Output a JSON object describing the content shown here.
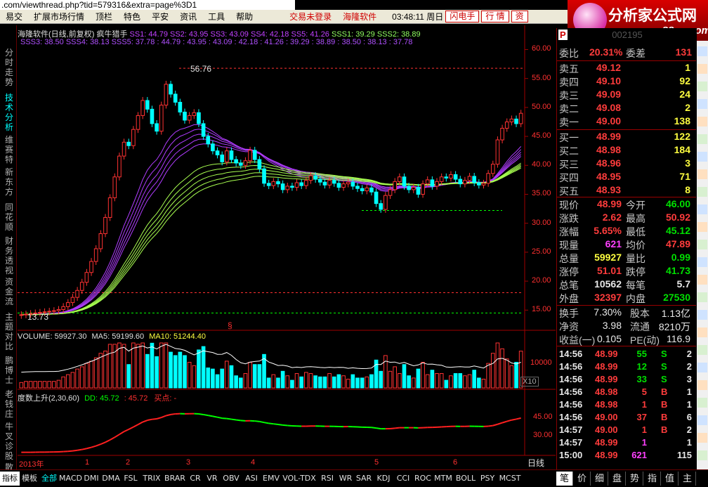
{
  "browser": {
    "url_text": ".com/viewthread.php?tid=579316&extra=page%3D1"
  },
  "menu": {
    "items": [
      "易交",
      "扩展市场行情",
      "顶栏",
      "特色",
      "平安",
      "资讯",
      "工具",
      "帮助"
    ],
    "login": "交易未登录",
    "brand": "海隆软件",
    "clock": "03:48:11 周日",
    "flash": "闪电手",
    "quote": "行 情",
    "info": "资"
  },
  "logo": {
    "title": "分析家公式网",
    "site": "www.88gs.com"
  },
  "left_tabs": [
    "分时走势",
    "技术分析",
    "维赛特",
    "新东方",
    "同花顺",
    "财务透视",
    "资金流",
    "主题对比",
    "鹏博士",
    "老钱庄",
    "牛叉诊股",
    "散户"
  ],
  "chart": {
    "title": "海隆软件(日线,前复权) 疯牛猎手",
    "ss": [
      {
        "label": "SS1: 44.79",
        "color": "#c040ff"
      },
      {
        "label": "SS2: 43.95",
        "color": "#c040ff"
      },
      {
        "label": "SS3: 43.09",
        "color": "#c040ff"
      },
      {
        "label": "SS4: 42.18",
        "color": "#c040ff"
      },
      {
        "label": "SS5: 41.26",
        "color": "#c040ff"
      },
      {
        "label": "SSS1: 39.29",
        "color": "#a0ff60"
      },
      {
        "label": "SSS2: 38.89",
        "color": "#a0ff60"
      }
    ],
    "line2": "SSS3: 38.50  SSS4: 38.13  SSS5: 37.78  :  44.79  : 43.95  : 43.09  : 42.18  : 41.26  : 39.29  : 38.89  : 38.50  : 38.13  : 37.78",
    "high_label": "56.76",
    "low_label": "13.73",
    "price_axis": [
      "60.00",
      "55.00",
      "50.00",
      "45.00",
      "40.00",
      "35.00",
      "30.00",
      "25.00",
      "20.00",
      "15.00"
    ],
    "volume_title": "VOLUME: 59927.30",
    "ma5": "MA5: 59199.60",
    "ma10": "MA10: 51244.40",
    "volume_axis": "10000",
    "volume_unit": "X10",
    "osc_title": "度数上升(2,30,60)",
    "dd": "DD: 45.72",
    "dd2": ": 45.72",
    "buy_point": "买点: -",
    "osc_axis": [
      "45.00",
      "30.00"
    ],
    "x_labels": [
      "2013年",
      "1",
      "2",
      "3",
      "4",
      "5",
      "6"
    ],
    "period": "日线",
    "mark": "§"
  },
  "chart_data": {
    "type": "candlestick",
    "title": "海隆软件(日线,前复权) 疯牛猎手",
    "ylim": [
      12,
      62
    ],
    "high": 56.76,
    "low": 13.73,
    "closes": [
      14.2,
      14.3,
      14.4,
      14.5,
      14.6,
      14.7,
      14.8,
      14.9,
      15.1,
      15.6,
      16.3,
      17.2,
      18.4,
      19.8,
      21.5,
      23.4,
      25.6,
      28.2,
      31.0,
      34.4,
      38.0,
      41.6,
      44.0,
      43.4,
      46.2,
      48.6,
      51.2,
      49.7,
      47.2,
      45.9,
      50.4,
      54.0,
      52.3,
      50.9,
      49.2,
      47.8,
      48.6,
      49.1,
      47.2,
      45.0,
      43.7,
      42.5,
      41.8,
      40.6,
      42.5,
      41.0,
      40.4,
      40.0,
      40.8,
      42.6,
      41.0,
      39.4,
      36.9,
      36.5,
      37.2,
      36.8,
      35.8,
      36.4,
      36.2,
      37.0,
      36.5,
      37.4,
      38.2,
      37.6,
      37.1,
      36.6,
      37.4,
      36.9,
      36.2,
      36.8,
      37.1,
      36.4,
      36.0,
      35.6,
      36.1,
      35.4,
      33.4,
      32.4,
      34.8,
      35.8,
      37.2,
      38.0,
      36.4,
      35.8,
      36.2,
      35.0,
      36.8,
      37.5,
      36.4,
      37.2,
      38.0,
      37.8,
      38.4,
      37.6,
      36.8,
      37.4,
      38.1,
      37.0,
      36.6,
      36.9,
      38.6,
      40.2,
      44.4,
      46.4,
      47.5,
      48.0,
      47.2,
      48.99
    ],
    "volume_ma5": 59199.6,
    "volume_ma10": 51244.4,
    "volume_last": 59927.3,
    "osc_last": 45.72
  },
  "panel": {
    "code": "002195",
    "weibi": {
      "label": "委比",
      "value": "20.31%",
      "label2": "委差",
      "value2": "131"
    },
    "sell": [
      {
        "label": "卖五",
        "price": "49.12",
        "vol": "1"
      },
      {
        "label": "卖四",
        "price": "49.10",
        "vol": "92"
      },
      {
        "label": "卖三",
        "price": "49.09",
        "vol": "24"
      },
      {
        "label": "卖二",
        "price": "49.08",
        "vol": "2"
      },
      {
        "label": "卖一",
        "price": "49.00",
        "vol": "138"
      }
    ],
    "buy": [
      {
        "label": "买一",
        "price": "48.99",
        "vol": "122"
      },
      {
        "label": "买二",
        "price": "48.98",
        "vol": "184"
      },
      {
        "label": "买三",
        "price": "48.96",
        "vol": "3"
      },
      {
        "label": "买四",
        "price": "48.95",
        "vol": "71"
      },
      {
        "label": "买五",
        "price": "48.93",
        "vol": "8"
      }
    ],
    "stats": [
      {
        "l1": "现价",
        "v1": "48.99",
        "c1": "pred",
        "l2": "今开",
        "v2": "46.00",
        "c2": "pgreen"
      },
      {
        "l1": "涨跌",
        "v1": "2.62",
        "c1": "pred",
        "l2": "最高",
        "v2": "50.92",
        "c2": "pred"
      },
      {
        "l1": "涨幅",
        "v1": "5.65%",
        "c1": "pred",
        "l2": "最低",
        "v2": "45.12",
        "c2": "pgreen"
      },
      {
        "l1": "现量",
        "v1": "621",
        "c1": "pmag",
        "l2": "均价",
        "v2": "47.89",
        "c2": "pred"
      },
      {
        "l1": "总量",
        "v1": "59927",
        "c1": "pyellow",
        "l2": "量比",
        "v2": "0.99",
        "c2": "pgreen"
      },
      {
        "l1": "涨停",
        "v1": "51.01",
        "c1": "pred",
        "l2": "跌停",
        "v2": "41.73",
        "c2": "pgreen"
      },
      {
        "l1": "总笔",
        "v1": "10562",
        "c1": "pwhite",
        "l2": "每笔",
        "v2": "5.7",
        "c2": "pwhite"
      },
      {
        "l1": "外盘",
        "v1": "32397",
        "c1": "pred",
        "l2": "内盘",
        "v2": "27530",
        "c2": "pgreen"
      }
    ],
    "fund": [
      {
        "l1": "换手",
        "v1": "7.30%",
        "l2": "股本",
        "v2": "1.13亿"
      },
      {
        "l1": "净资",
        "v1": "3.98",
        "l2": "流通",
        "v2": "8210万"
      },
      {
        "l1": "收益(一)",
        "v1": "0.105",
        "l2": "PE(动)",
        "v2": "116.9"
      }
    ],
    "ticks": [
      {
        "time": "14:56",
        "price": "48.99",
        "vol": "55",
        "bs": "S",
        "n": "2"
      },
      {
        "time": "14:56",
        "price": "48.99",
        "vol": "12",
        "bs": "S",
        "n": "2"
      },
      {
        "time": "14:56",
        "price": "48.99",
        "vol": "33",
        "bs": "S",
        "n": "3"
      },
      {
        "time": "14:56",
        "price": "48.98",
        "vol": "5",
        "bs": "B",
        "n": "1"
      },
      {
        "time": "14:56",
        "price": "48.98",
        "vol": "1",
        "bs": "B",
        "n": "1"
      },
      {
        "time": "14:56",
        "price": "49.00",
        "vol": "37",
        "bs": "B",
        "n": "6"
      },
      {
        "time": "14:57",
        "price": "49.00",
        "vol": "1",
        "bs": "B",
        "n": "2"
      },
      {
        "time": "14:57",
        "price": "48.99",
        "vol": "1",
        "bs": "",
        "n": "1"
      },
      {
        "time": "15:00",
        "price": "48.99",
        "vol": "621",
        "bs": "",
        "n": "115"
      }
    ]
  },
  "bottom": {
    "tabs": [
      "指标",
      "模板",
      "全部",
      "MACD",
      "DMI",
      "DMA",
      "FSL",
      "TRIX",
      "BRAR",
      "CR",
      "VR",
      "OBV",
      "ASI",
      "EMV",
      "VOL-TDX",
      "RSI",
      "WR",
      "SAR",
      "KDJ",
      "CCI",
      "ROC",
      "MTM",
      "BOLL",
      "PSY",
      "MCST"
    ],
    "right_tabs": [
      "笔",
      "价",
      "细",
      "盘",
      "势",
      "指",
      "值",
      "主"
    ]
  },
  "colors": {
    "up": "#ff3232",
    "down": "#00ffff",
    "purple": "#b03cff",
    "lime": "#a8ff50",
    "panel_sep": "#990000"
  }
}
